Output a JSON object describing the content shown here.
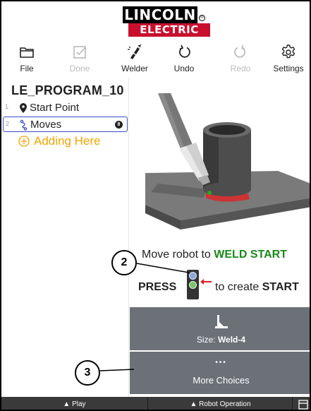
{
  "logo": {
    "top": "LINCOLN",
    "bottom": "ELECTRIC",
    "registered": "®"
  },
  "toolbar": {
    "file": "File",
    "done": "Done",
    "welder": "Welder",
    "undo": "Undo",
    "redo": "Redo",
    "settings": "Settings"
  },
  "program": {
    "title": "LE_PROGRAM_10",
    "steps": [
      {
        "num": "1",
        "label": "Start Point",
        "icon": "map-pin-icon"
      },
      {
        "num": "2",
        "label": "Moves",
        "icon": "path-icon",
        "badge": "8"
      }
    ],
    "adding": "Adding Here"
  },
  "instructions": {
    "move_prefix": "Move robot to ",
    "move_target": "WELD START",
    "press": "PRESS",
    "create_prefix": "to create ",
    "create_target": "START"
  },
  "choices": {
    "size_prefix": "Size: ",
    "size_value": "Weld-4",
    "more_dots": "•••",
    "more_label": "More Choices"
  },
  "callouts": {
    "two": "2",
    "three": "3"
  },
  "bottom_bar": {
    "play": "▲ Play",
    "robot_operation": "▲ Robot Operation"
  },
  "colors": {
    "accent_red": "#c8102e",
    "selection_blue": "#3a4cc9",
    "add_orange": "#f0a500",
    "weld_green": "#1a8a1a",
    "button_gray": "#6b7177",
    "bottom_bar": "#3a3a3a"
  }
}
